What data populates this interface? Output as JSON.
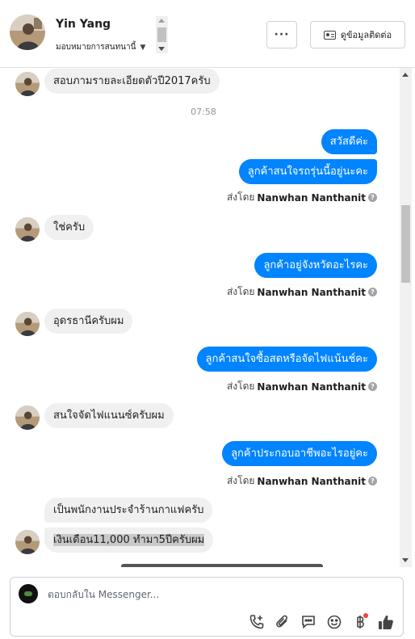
{
  "header": {
    "contact_name": "Yin Yang",
    "assign_label": "มอบหมายการสนทนานี้",
    "more_label": "···",
    "contact_info_label": "ดูข้อมูลติดต่อ"
  },
  "chat": {
    "timestamp": "07:58",
    "sent_by_prefix": "ส่งโดย",
    "sender_name": "Nanwhan Nanthanit",
    "messages": [
      {
        "dir": "in",
        "text": "สอบภามรายละเอียดตัวปี2017ครับ"
      },
      {
        "dir": "out",
        "text": "สวัสดีค่ะ"
      },
      {
        "dir": "out",
        "text": "ลูกค้าสนใจรถรุ่นนี้อยู่นะคะ"
      },
      {
        "dir": "in",
        "text": "ใช่ครับ"
      },
      {
        "dir": "out",
        "text": "ลูกค้าอยู่จังหวัดอะไรคะ"
      },
      {
        "dir": "in",
        "text": "อุดรธานีครับผม"
      },
      {
        "dir": "out",
        "text": "ลูกค้าสนใจซื้อสดหรือจัดไฟแน้นช์คะ"
      },
      {
        "dir": "in",
        "text": "สนใจจัดไฟแนนซ์ครับผม"
      },
      {
        "dir": "out",
        "text": "ลูกค้าประกอบอาชีพอะไรอยู่คะ"
      },
      {
        "dir": "in",
        "text": "เป็นพนักงานประจำร้านกาแฟครับ"
      },
      {
        "dir": "in",
        "text": "เงินเดือน11,000 ทำมา5ปีครับผม"
      }
    ]
  },
  "composer": {
    "placeholder": "ตอบกลับใน Messenger...",
    "tools": [
      "phone-plus-icon",
      "paperclip-icon",
      "saved-reply-icon",
      "emoji-icon",
      "baht-icon",
      "thumbs-up-icon"
    ]
  },
  "colors": {
    "outgoing_bubble": "#0084ff",
    "incoming_bubble": "#f0f0f0",
    "notification_dot": "#fa3e3e"
  }
}
